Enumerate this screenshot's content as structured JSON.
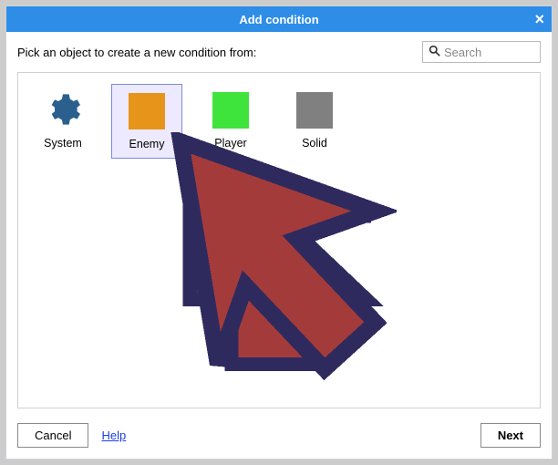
{
  "dialog": {
    "title": "Add condition",
    "close_label": "×"
  },
  "prompt": "Pick an object to create a new condition from:",
  "search": {
    "placeholder": "Search",
    "value": ""
  },
  "objects": [
    {
      "id": "system",
      "label": "System",
      "kind": "system",
      "color": "#2b5f8e",
      "selected": false
    },
    {
      "id": "enemy",
      "label": "Enemy",
      "kind": "swatch",
      "color": "#e6941a",
      "selected": true
    },
    {
      "id": "player",
      "label": "Player",
      "kind": "swatch",
      "color": "#3ee33c",
      "selected": false
    },
    {
      "id": "solid",
      "label": "Solid",
      "kind": "swatch",
      "color": "#808080",
      "selected": false
    }
  ],
  "buttons": {
    "cancel": "Cancel",
    "help": "Help",
    "next": "Next"
  },
  "cursor_overlay": {
    "fill": "#a43b3b",
    "outline": "#2f2a5e"
  }
}
